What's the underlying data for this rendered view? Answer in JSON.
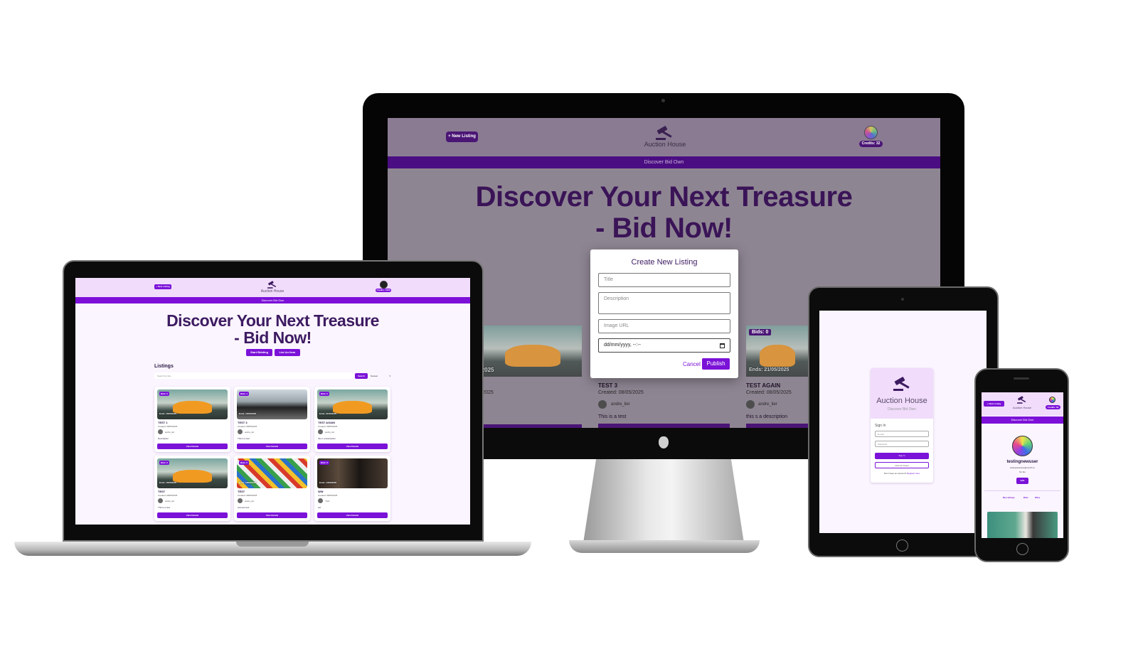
{
  "app": {
    "brand": "Auction House",
    "tagline": "Discover Bid Own",
    "new_listing": "+ New Listing",
    "credits_desktop": "Credits: 32",
    "credits_laptop": "Credits: 1000",
    "credits_phone": "Credits: 32",
    "hero": "Discover Your Next Treasure - Bid Now!",
    "hero_line1": "Discover Your Next Treasure",
    "hero_line2": "- Bid Now!",
    "start_bidding": "Start Bidding",
    "list_item": "List An Item",
    "listings_heading": "Listings",
    "search_placeholder": "Search by title...",
    "search_btn": "Search",
    "sort_value": "Newest",
    "view_details": "View Details"
  },
  "laptop_cards": [
    {
      "bids": "Bids: 0",
      "ends": "Ends: 15/05/2025",
      "title": "TEST 1",
      "created": "Created: 08/05/2025",
      "user": "andre_lier",
      "desc": "Description",
      "img": "car"
    },
    {
      "bids": "Bids: 1",
      "ends": "Ends: 15/05/2025",
      "title": "TEST 3",
      "created": "Created: 08/05/2025",
      "user": "andre_lier",
      "desc": "This is a test",
      "img": "dark"
    },
    {
      "bids": "Bids: 0",
      "ends": "Ends: 21/05/2025",
      "title": "TEST AGAIN",
      "created": "Created: 08/05/2025",
      "user": "andre_lier",
      "desc": "this s a description",
      "img": "car"
    },
    {
      "bids": "Bids: 0",
      "ends": "Ends: 15/05/2025",
      "title": "TEST",
      "created": "Created: 08/05/2025",
      "user": "andre_lier",
      "desc": "This is a test",
      "img": "car"
    },
    {
      "bids": "Bids: 0",
      "ends": "Ends: 20/05/2025",
      "title": "TEST",
      "created": "Created: 08/05/2025",
      "user": "andre_lier",
      "desc": "test test test",
      "img": "lego"
    },
    {
      "bids": "Bids: 0",
      "ends": "Ends: 14/05/2025",
      "title": "WW",
      "created": "Created: 08/05/2025",
      "user": "Yiwit",
      "desc": "ww",
      "img": "room"
    }
  ],
  "desktop_cards": [
    {
      "ends": "Ends: 15/05/2025",
      "created": "Created: 08/05/2025"
    },
    {
      "title": "TEST 3",
      "created": "Created: 08/05/2025",
      "user": "andre_lier",
      "desc": "This is a test"
    },
    {
      "bids": "Bids: 0",
      "ends": "Ends: 21/05/2025",
      "title": "TEST AGAIN",
      "created": "Created: 08/05/2025",
      "user": "andre_lier",
      "desc": "this s a description"
    }
  ],
  "modal": {
    "title": "Create New Listing",
    "title_ph": "Title",
    "desc_ph": "Description",
    "image_ph": "Image URL",
    "date_value": "dd/mm/yyyy, --:--",
    "cancel": "Cancel",
    "publish": "Publish"
  },
  "tablet": {
    "brand": "Auction House",
    "tagline": "Discover Bid Own",
    "sign_in": "Sign In",
    "email_ph": "E-mail",
    "password_ph": "Password",
    "sign_in_btn": "Sign In",
    "guest_btn": "View as Guest",
    "no_account": "Don't have an account?",
    "register": "Register here"
  },
  "phone": {
    "username": "testingnewuser",
    "email": "testingnewuser@noroff.no",
    "bio": "No bio",
    "edit": "Edit",
    "tabs": [
      "My Listings",
      "Bids",
      "Wins"
    ]
  },
  "colors": {
    "accent": "#7b12d8",
    "header": "#f1dcfc",
    "hero_text": "#3d1b61"
  }
}
